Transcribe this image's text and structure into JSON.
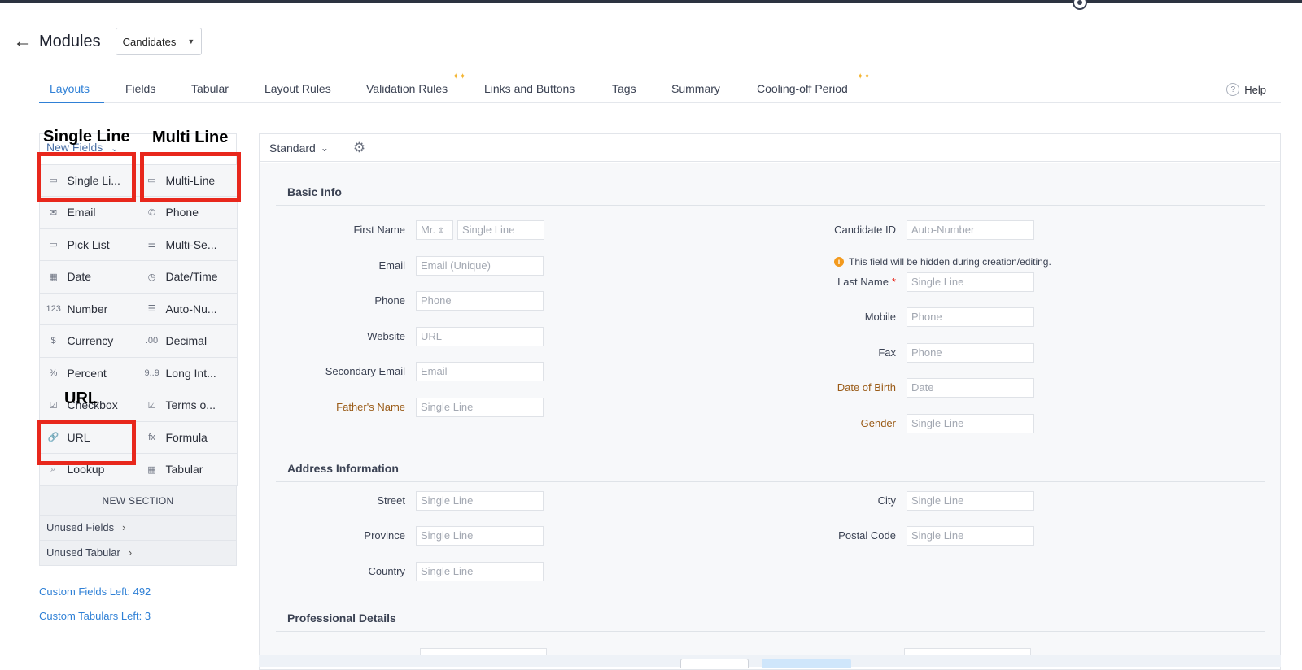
{
  "header": {
    "back_icon": "arrow-left-icon",
    "title": "Modules",
    "module_selected": "Candidates"
  },
  "tabs": [
    {
      "label": "Layouts",
      "active": true
    },
    {
      "label": "Fields"
    },
    {
      "label": "Tabular"
    },
    {
      "label": "Layout Rules"
    },
    {
      "label": "Validation Rules",
      "badge": "sparkle"
    },
    {
      "label": "Links and Buttons"
    },
    {
      "label": "Tags"
    },
    {
      "label": "Summary"
    },
    {
      "label": "Cooling-off Period",
      "badge": "sparkle"
    }
  ],
  "help": {
    "label": "Help",
    "icon": "?"
  },
  "left_panel": {
    "header": "New Fields",
    "fields": [
      {
        "label": "Single Li...",
        "icon": "single-line-icon",
        "glyph": "▭"
      },
      {
        "label": "Multi-Line",
        "icon": "multi-line-icon",
        "glyph": "▭"
      },
      {
        "label": "Email",
        "icon": "email-icon",
        "glyph": "✉"
      },
      {
        "label": "Phone",
        "icon": "phone-icon",
        "glyph": "✆"
      },
      {
        "label": "Pick List",
        "icon": "pick-list-icon",
        "glyph": "▭"
      },
      {
        "label": "Multi-Se...",
        "icon": "multi-select-icon",
        "glyph": "☰"
      },
      {
        "label": "Date",
        "icon": "date-icon",
        "glyph": "▦"
      },
      {
        "label": "Date/Time",
        "icon": "date-time-icon",
        "glyph": "◷"
      },
      {
        "label": "Number",
        "icon": "number-icon",
        "glyph": "123"
      },
      {
        "label": "Auto-Nu...",
        "icon": "auto-number-icon",
        "glyph": "☰"
      },
      {
        "label": "Currency",
        "icon": "currency-icon",
        "glyph": "$"
      },
      {
        "label": "Decimal",
        "icon": "decimal-icon",
        "glyph": ".00"
      },
      {
        "label": "Percent",
        "icon": "percent-icon",
        "glyph": "%"
      },
      {
        "label": "Long Int...",
        "icon": "long-integer-icon",
        "glyph": "9..9"
      },
      {
        "label": "Checkbox",
        "icon": "checkbox-icon",
        "glyph": "☑"
      },
      {
        "label": "Terms o...",
        "icon": "terms-icon",
        "glyph": "☑"
      },
      {
        "label": "URL",
        "icon": "link-icon",
        "glyph": "🔗"
      },
      {
        "label": "Formula",
        "icon": "formula-icon",
        "glyph": "fx"
      },
      {
        "label": "Lookup",
        "icon": "lookup-icon",
        "glyph": "⌕"
      },
      {
        "label": "Tabular",
        "icon": "tabular-icon",
        "glyph": "▦"
      }
    ],
    "new_section": "NEW SECTION",
    "unused_fields": "Unused Fields",
    "unused_tabular": "Unused Tabular",
    "custom_fields_left": "Custom Fields Left: 492",
    "custom_tabulars_left": "Custom Tabulars Left: 3"
  },
  "annotations": {
    "single_line": "Single Line",
    "multi_line": "Multi Line",
    "url": "URL"
  },
  "canvas": {
    "layout_name": "Standard",
    "sections": {
      "basic": "Basic Info",
      "address": "Address Information",
      "professional": "Professional Details"
    },
    "basic_left": [
      {
        "label": "First Name",
        "salutation": "Mr.",
        "placeholder": "Single Line"
      },
      {
        "label": "Email",
        "placeholder": "Email (Unique)"
      },
      {
        "label": "Phone",
        "placeholder": "Phone"
      },
      {
        "label": "Website",
        "placeholder": "URL"
      },
      {
        "label": "Secondary Email",
        "placeholder": "Email"
      },
      {
        "label": "Father's Name",
        "placeholder": "Single Line"
      }
    ],
    "basic_right": [
      {
        "label": "Candidate ID",
        "placeholder": "Auto-Number"
      },
      {
        "label": "Last Name",
        "placeholder": "Single Line",
        "required": "*"
      },
      {
        "label": "Mobile",
        "placeholder": "Phone"
      },
      {
        "label": "Fax",
        "placeholder": "Phone"
      },
      {
        "label": "Date of Birth",
        "placeholder": "Date"
      },
      {
        "label": "Gender",
        "placeholder": "Single Line"
      }
    ],
    "hidden_note": "This field will be hidden during creation/editing.",
    "address_left": [
      {
        "label": "Street",
        "placeholder": "Single Line"
      },
      {
        "label": "Province",
        "placeholder": "Single Line"
      },
      {
        "label": "Country",
        "placeholder": "Single Line"
      }
    ],
    "address_right": [
      {
        "label": "City",
        "placeholder": "Single Line"
      },
      {
        "label": "Postal Code",
        "placeholder": "Single Line"
      }
    ]
  }
}
